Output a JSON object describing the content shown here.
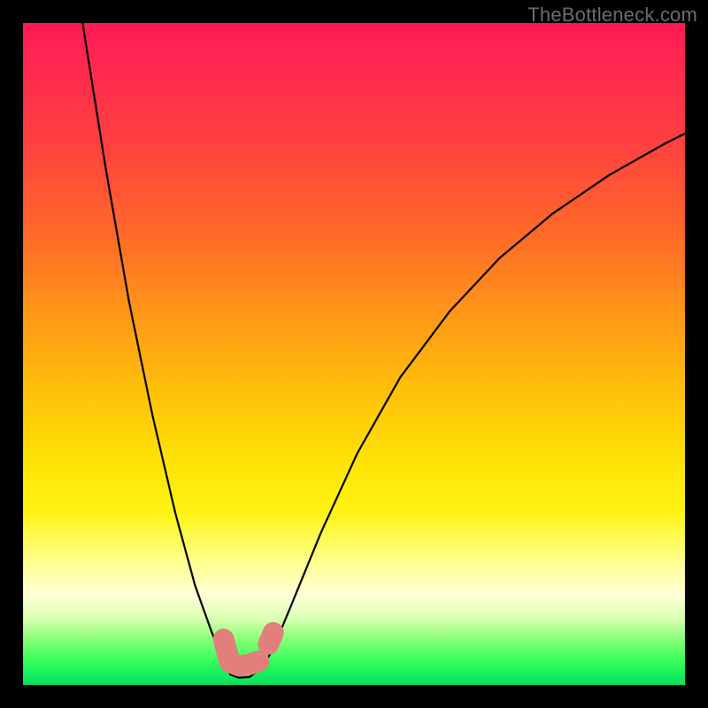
{
  "watermark": "TheBottleneck.com",
  "chart_data": {
    "type": "line",
    "title": "",
    "xlabel": "",
    "ylabel": "",
    "xlim": [
      0,
      100
    ],
    "ylim": [
      0,
      100
    ],
    "grid": false,
    "series": [
      {
        "name": "bottleneck-curve",
        "points": [
          {
            "x": 9.0,
            "y": 100.0
          },
          {
            "x": 12.5,
            "y": 78.0
          },
          {
            "x": 16.0,
            "y": 58.0
          },
          {
            "x": 19.5,
            "y": 41.0
          },
          {
            "x": 23.0,
            "y": 26.0
          },
          {
            "x": 26.0,
            "y": 15.0
          },
          {
            "x": 28.5,
            "y": 8.0
          },
          {
            "x": 30.3,
            "y": 3.5
          },
          {
            "x": 31.3,
            "y": 1.6
          },
          {
            "x": 32.6,
            "y": 1.1
          },
          {
            "x": 34.2,
            "y": 1.2
          },
          {
            "x": 36.2,
            "y": 2.7
          },
          {
            "x": 37.8,
            "y": 5.5
          },
          {
            "x": 40.5,
            "y": 12.0
          },
          {
            "x": 45.0,
            "y": 23.0
          },
          {
            "x": 50.5,
            "y": 35.0
          },
          {
            "x": 57.0,
            "y": 46.5
          },
          {
            "x": 64.5,
            "y": 56.5
          },
          {
            "x": 72.0,
            "y": 64.5
          },
          {
            "x": 80.0,
            "y": 71.2
          },
          {
            "x": 88.5,
            "y": 77.0
          },
          {
            "x": 97.0,
            "y": 81.8
          },
          {
            "x": 100.0,
            "y": 83.3
          }
        ]
      }
    ],
    "markers": [
      {
        "stroke": [
          {
            "x": 30.3,
            "y": 6.9
          },
          {
            "x": 30.8,
            "y": 5.0
          },
          {
            "x": 31.3,
            "y": 3.4
          },
          {
            "x": 32.6,
            "y": 2.9
          },
          {
            "x": 34.2,
            "y": 3.1
          },
          {
            "x": 35.6,
            "y": 3.6
          }
        ]
      },
      {
        "stroke": [
          {
            "x": 37.1,
            "y": 6.2
          },
          {
            "x": 37.8,
            "y": 7.9
          }
        ]
      }
    ],
    "colors": {
      "curve": "#000000",
      "marker": "#e27f7d",
      "gradient": [
        "#ff1a55",
        "#ffe205",
        "#0adf60"
      ]
    }
  }
}
